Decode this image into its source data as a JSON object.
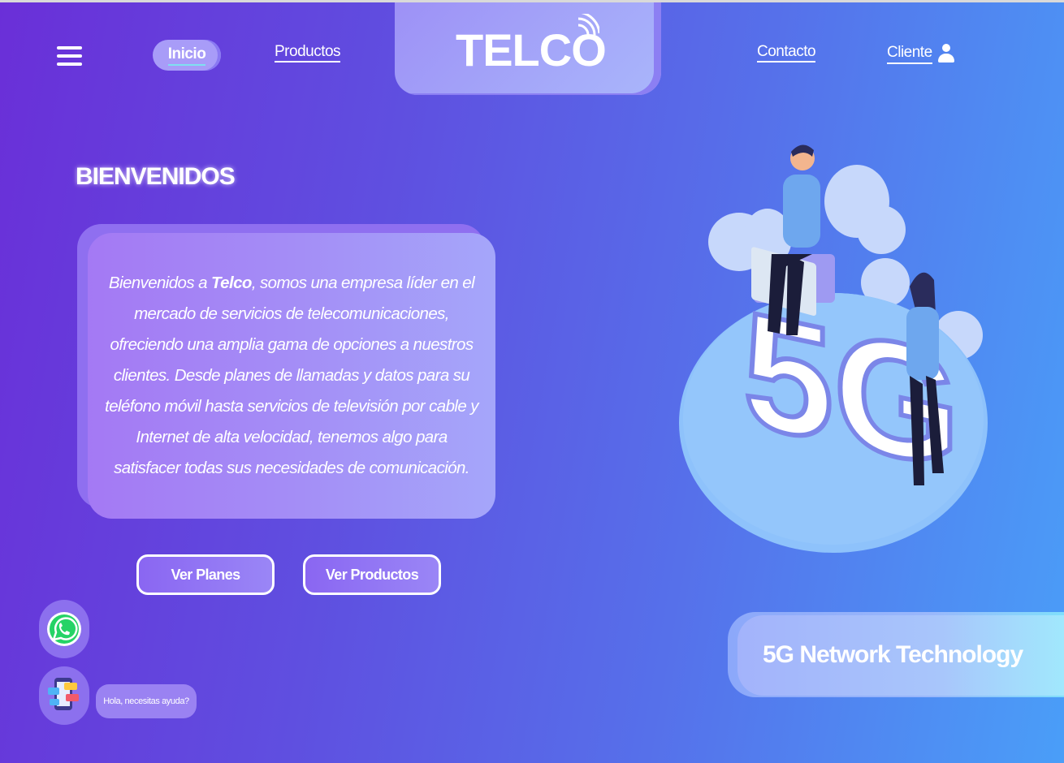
{
  "header": {
    "menu_icon": "hamburger-menu-icon",
    "nav": {
      "inicio": "Inicio",
      "productos": "Productos",
      "contacto": "Contacto",
      "cliente": "Cliente"
    },
    "logo": "TELCO"
  },
  "hero": {
    "title": "BIENVENIDOS",
    "intro_prefix": "Bienvenidos a ",
    "intro_brand": "Telco",
    "intro_rest": ", somos una empresa líder en el mercado de servicios de telecomunicaciones, ofreciendo una amplia gama de opciones a nuestros clientes. Desde planes de llamadas y datos para su teléfono móvil hasta servicios de televisión por cable y Internet de alta velocidad, tenemos algo para satisfacer todas sus necesidades de comunicación.",
    "buttons": {
      "plans": "Ver Planes",
      "products": "Ver Productos"
    }
  },
  "illustration": {
    "label": "5G"
  },
  "feature": {
    "title": "5G Network Technology"
  },
  "widgets": {
    "whatsapp_icon": "whatsapp-icon",
    "chat_icon": "chat-phone-icon",
    "chat_prompt": "Hola, necesitas ayuda?"
  },
  "colors": {
    "gradient_start": "#6a2fd8",
    "gradient_end": "#4a9ef8",
    "accent": "#a89cf8",
    "whatsapp": "#25d366"
  }
}
